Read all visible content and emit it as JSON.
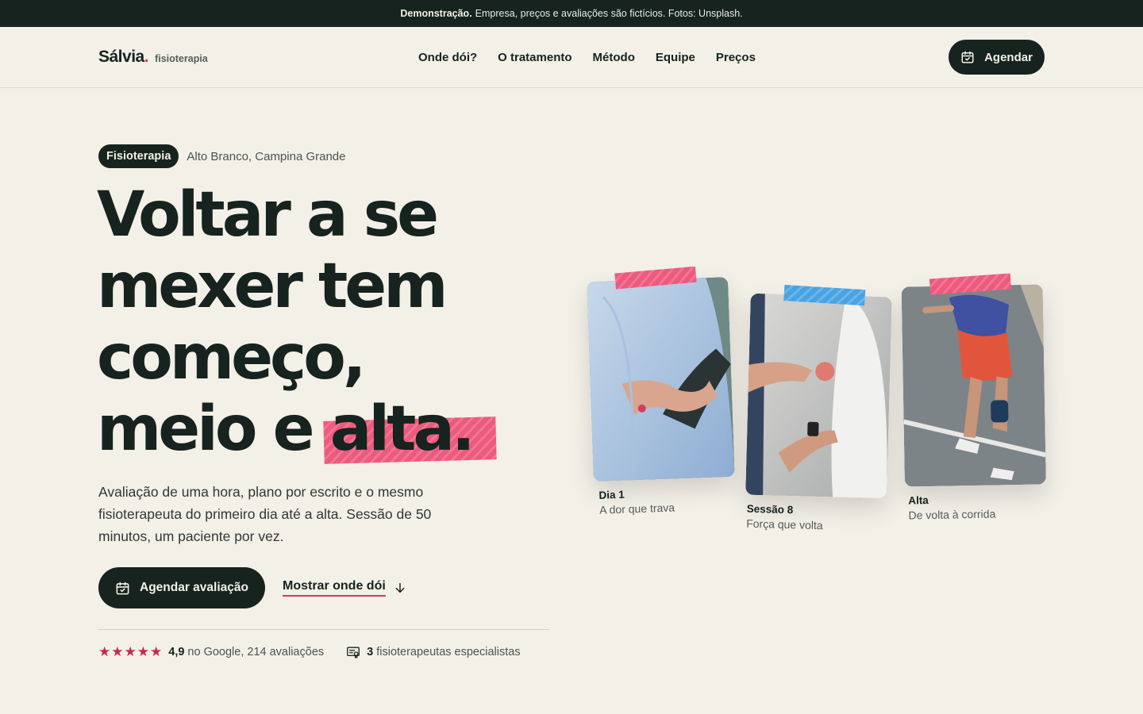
{
  "banner": {
    "bold": "Demonstração.",
    "text": "Empresa, preços e avaliações são fictícios. Fotos: Unsplash."
  },
  "brand": {
    "name": "Sálvia",
    "dot": ".",
    "sub": "fisioterapia"
  },
  "nav": {
    "items": [
      "Onde dói?",
      "O tratamento",
      "Método",
      "Equipe",
      "Preços"
    ]
  },
  "header_cta": "Agendar",
  "hero": {
    "tag": "Fisioterapia",
    "location": "Alto Branco, Campina Grande",
    "title_a": "Voltar a se mexer tem começo, meio e ",
    "title_b": "alta.",
    "lead": "Avaliação de uma hora, plano por escrito e o mesmo fisioterapeuta do primeiro dia até a alta. Sessão de 50 minutos, um paciente por vez.",
    "cta": "Agendar avaliação",
    "link": "Mostrar onde dói"
  },
  "proof": {
    "rating": "4,9",
    "rating_text": "no Google, 214 avaliações",
    "count": "3",
    "count_text": "fisioterapeutas especialistas"
  },
  "cards": [
    {
      "title": "Dia 1",
      "subtitle": "A dor que trava"
    },
    {
      "title": "Sessão 8",
      "subtitle": "Força que volta"
    },
    {
      "title": "Alta",
      "subtitle": "De volta à corrida"
    }
  ],
  "colors": {
    "ink": "#16231e",
    "accent": "#d43d63",
    "background": "#f3f0e8",
    "tape_blue": "#4aa3e0"
  }
}
